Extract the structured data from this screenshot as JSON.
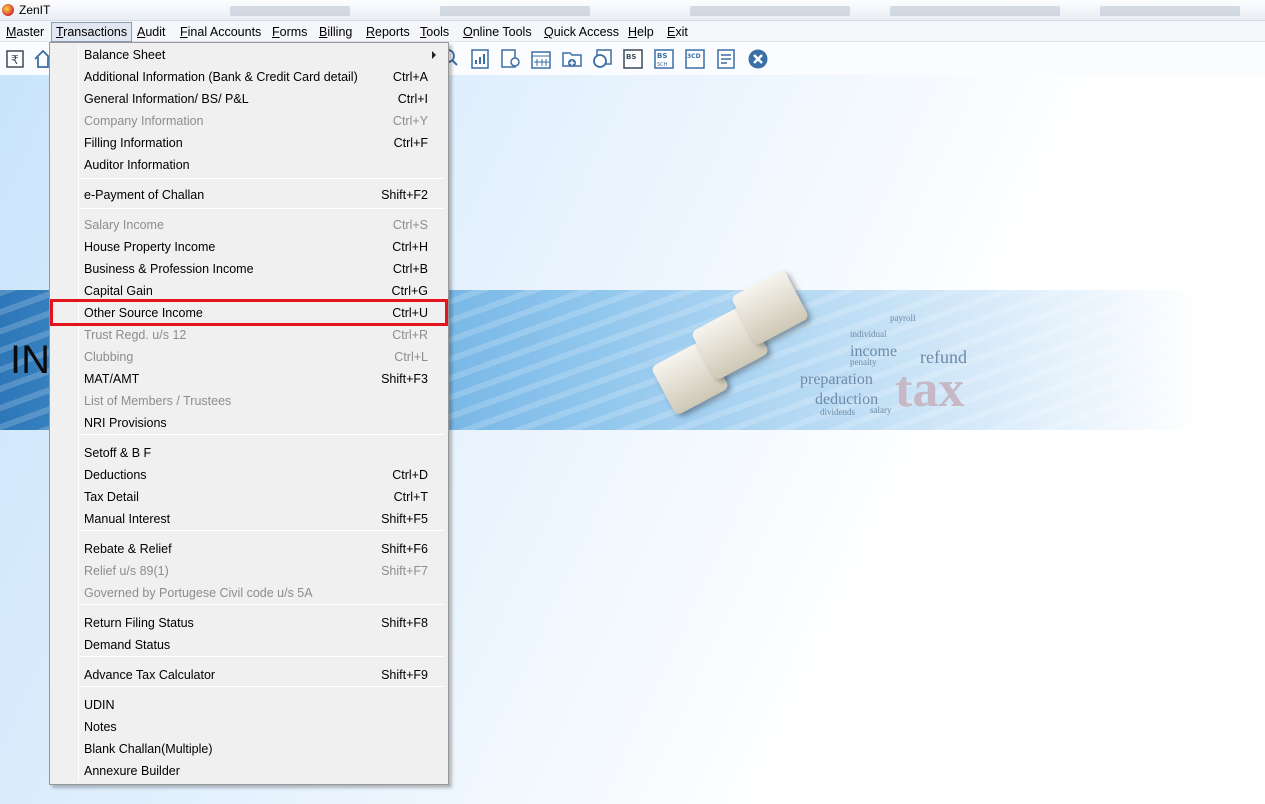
{
  "window": {
    "title": "ZenIT"
  },
  "menubar": {
    "items": [
      {
        "id": "master",
        "label": "Master",
        "u": "M",
        "rest": "aster"
      },
      {
        "id": "transactions",
        "label": "Transactions",
        "u": "T",
        "rest": "ransactions"
      },
      {
        "id": "audit",
        "label": "Audit",
        "u": "A",
        "rest": "udit"
      },
      {
        "id": "final-accounts",
        "label": "Final Accounts",
        "u": "F",
        "rest": "inal Accounts"
      },
      {
        "id": "forms",
        "label": "Forms",
        "u": "F",
        "rest": "orms"
      },
      {
        "id": "billing",
        "label": "Billing",
        "u": "B",
        "rest": "illing"
      },
      {
        "id": "reports",
        "label": "Reports",
        "u": "R",
        "rest": "eports"
      },
      {
        "id": "tools",
        "label": "Tools",
        "u": "T",
        "rest": "ools"
      },
      {
        "id": "online-tools",
        "label": "Online Tools",
        "u": "O",
        "rest": "nline Tools"
      },
      {
        "id": "quick-access",
        "label": "Quick Access",
        "u": "Q",
        "rest": "uick Access"
      },
      {
        "id": "help",
        "label": "Help",
        "u": "H",
        "rest": "elp"
      },
      {
        "id": "exit",
        "label": "Exit",
        "u": "E",
        "rest": "xit"
      }
    ]
  },
  "toolbar": {
    "icons": [
      "rupee-book-icon",
      "home-icon",
      "search-doc-icon",
      "report-icon",
      "user-doc-icon",
      "calendar-icon",
      "add-folder-icon",
      "search-icon",
      "bs-icon",
      "bs-sch-icon",
      "3cd-icon",
      "form-icon",
      "close-icon"
    ],
    "labels": {
      "bs": "BS",
      "bs_sch": "BS",
      "bs_sch_sub": "SCH",
      "cd": "3CD"
    }
  },
  "transactions_menu": {
    "items": [
      {
        "label": "Balance Sheet",
        "shortcut": "",
        "disabled": false,
        "submenu": true
      },
      {
        "label": "Additional Information (Bank & Credit Card detail)",
        "shortcut": "Ctrl+A",
        "disabled": false
      },
      {
        "label": "General Information/ BS/ P&L",
        "shortcut": "Ctrl+I",
        "disabled": false
      },
      {
        "label": "Company Information",
        "shortcut": "Ctrl+Y",
        "disabled": true
      },
      {
        "label": "Filling Information",
        "shortcut": "Ctrl+F",
        "disabled": false
      },
      {
        "label": "Auditor Information",
        "shortcut": "",
        "disabled": false
      },
      {
        "label": "e-Payment of Challan",
        "shortcut": "Shift+F2",
        "disabled": false
      },
      {
        "label": "Salary Income",
        "shortcut": "Ctrl+S",
        "disabled": true
      },
      {
        "label": "House Property Income",
        "shortcut": "Ctrl+H",
        "disabled": false
      },
      {
        "label": "Business & Profession Income",
        "shortcut": "Ctrl+B",
        "disabled": false
      },
      {
        "label": "Capital Gain",
        "shortcut": "Ctrl+G",
        "disabled": false
      },
      {
        "label": "Other Source Income",
        "shortcut": "Ctrl+U",
        "disabled": false,
        "highlighted": true
      },
      {
        "label": "Trust Regd. u/s 12",
        "shortcut": "Ctrl+R",
        "disabled": true
      },
      {
        "label": "Clubbing",
        "shortcut": "Ctrl+L",
        "disabled": true
      },
      {
        "label": "MAT/AMT",
        "shortcut": "Shift+F3",
        "disabled": false
      },
      {
        "label": "List of Members / Trustees",
        "shortcut": "",
        "disabled": true
      },
      {
        "label": "NRI Provisions",
        "shortcut": "",
        "disabled": false
      },
      {
        "label": "Setoff & B F",
        "shortcut": "",
        "disabled": false
      },
      {
        "label": "Deductions",
        "shortcut": "Ctrl+D",
        "disabled": false
      },
      {
        "label": "Tax Detail",
        "shortcut": "Ctrl+T",
        "disabled": false
      },
      {
        "label": "Manual Interest",
        "shortcut": "Shift+F5",
        "disabled": false
      },
      {
        "label": "Rebate & Relief",
        "shortcut": "Shift+F6",
        "disabled": false
      },
      {
        "label": "Relief u/s 89(1)",
        "shortcut": "Shift+F7",
        "disabled": true
      },
      {
        "label": "Governed by Portugese Civil code u/s 5A",
        "shortcut": "",
        "disabled": true
      },
      {
        "label": "Return Filing Status",
        "shortcut": "Shift+F8",
        "disabled": false
      },
      {
        "label": "Demand Status",
        "shortcut": "",
        "disabled": false
      },
      {
        "label": "Advance Tax Calculator",
        "shortcut": "Shift+F9",
        "disabled": false
      },
      {
        "label": "UDIN",
        "shortcut": "",
        "disabled": false
      },
      {
        "label": "Notes",
        "shortcut": "",
        "disabled": false
      },
      {
        "label": "Blank Challan(Multiple)",
        "shortcut": "",
        "disabled": false
      },
      {
        "label": "Annexure Builder",
        "shortcut": "",
        "disabled": false
      }
    ]
  },
  "banner": {
    "text": "INC",
    "words": [
      "payroll",
      "income",
      "refund",
      "penalty",
      "preparation",
      "deduction",
      "tax",
      "salary",
      "dividends",
      "individual"
    ],
    "key_letters": [
      "T",
      "A",
      "X"
    ]
  },
  "colors": {
    "highlight": "#e3141b",
    "disabled_text": "#8d8d8d",
    "menu_bg": "#f0f0f0"
  }
}
